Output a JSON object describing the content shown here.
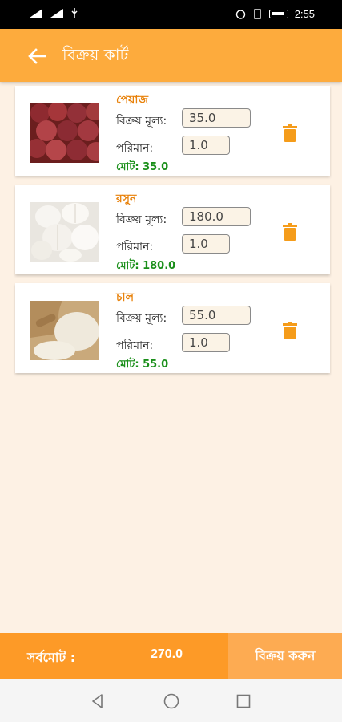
{
  "status_bar": {
    "time": "2:55"
  },
  "app_bar": {
    "title": "বিক্রয় কার্ট"
  },
  "items": [
    {
      "name": "পেয়াজ",
      "price_label": "বিক্রয় মূল্য:",
      "price": "35.0",
      "qty_label": "পরিমান:",
      "qty": "1.0",
      "total": "মোট:  35.0",
      "image": "onion-image"
    },
    {
      "name": "রসুন",
      "price_label": "বিক্রয় মূল্য:",
      "price": "180.0",
      "qty_label": "পরিমান:",
      "qty": "1.0",
      "total": "মোট:  180.0",
      "image": "garlic-image"
    },
    {
      "name": "চাল",
      "price_label": "বিক্রয় মূল্য:",
      "price": "55.0",
      "qty_label": "পরিমান:",
      "qty": "1.0",
      "total": "মোট:  55.0",
      "image": "rice-image"
    }
  ],
  "footer": {
    "grand_total_label": "সর্বমোট :",
    "grand_total": "270.0",
    "sell_button": "বিক্রয় করুন"
  },
  "colors": {
    "accent": "#fdab3d",
    "footer": "#fd9a27",
    "item_name": "#e8810a",
    "total": "#1a8f1a",
    "trash": "#f59c1a"
  },
  "icons": {
    "back": "arrow-left-icon",
    "delete": "trash-icon",
    "nav_back": "triangle-back-icon",
    "nav_home": "circle-home-icon",
    "nav_recent": "square-recent-icon"
  }
}
